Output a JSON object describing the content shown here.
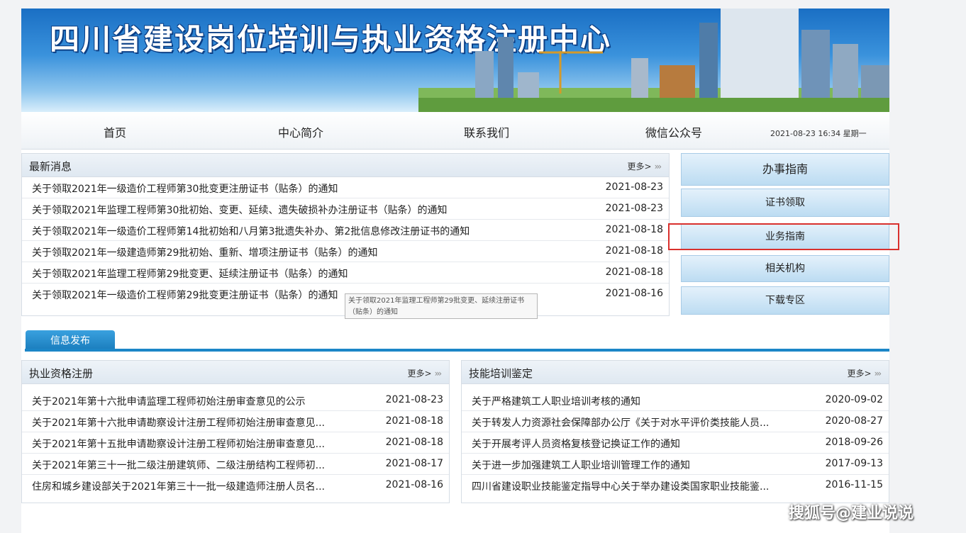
{
  "header": {
    "site_title": "四川省建设岗位培训与执业资格注册中心"
  },
  "nav": {
    "items": [
      "首页",
      "中心简介",
      "联系我们",
      "微信公众号"
    ],
    "datetime": "2021-08-23 16:34 星期一"
  },
  "news": {
    "title": "最新消息",
    "more": "更多>",
    "items": [
      {
        "text": "关于领取2021年一级造价工程师第30批变更注册证书（贴条）的通知",
        "date": "2021-08-23"
      },
      {
        "text": "关于领取2021年监理工程师第30批初始、变更、延续、遗失破损补办注册证书（贴条）的通知",
        "date": "2021-08-23"
      },
      {
        "text": "关于领取2021年一级造价工程师第14批初始和八月第3批遗失补办、第2批信息修改注册证书的通知",
        "date": "2021-08-18"
      },
      {
        "text": "关于领取2021年一级建造师第29批初始、重新、增项注册证书（贴条）的通知",
        "date": "2021-08-18"
      },
      {
        "text": "关于领取2021年监理工程师第29批变更、延续注册证书（贴条）的通知",
        "date": "2021-08-18"
      },
      {
        "text": "关于领取2021年一级造价工程师第29批变更注册证书（贴条）的通知",
        "date": "2021-08-16"
      }
    ],
    "tooltip": "关于领取2021年监理工程师第29批变更、延续注册证书（贴条）的通知"
  },
  "sidebar": {
    "items": [
      "办事指南",
      "证书领取",
      "业务指南",
      "相关机构",
      "下载专区"
    ]
  },
  "tab": {
    "label": "信息发布"
  },
  "registration": {
    "title": "执业资格注册",
    "more": "更多>",
    "items": [
      {
        "text": "关于2021年第十六批申请监理工程师初始注册审查意见的公示",
        "date": "2021-08-23"
      },
      {
        "text": "关于2021年第十六批申请勘察设计注册工程师初始注册审查意见...",
        "date": "2021-08-18"
      },
      {
        "text": "关于2021年第十五批申请勘察设计注册工程师初始注册审查意见...",
        "date": "2021-08-18"
      },
      {
        "text": "关于2021年第三十一批二级注册建筑师、二级注册结构工程师初...",
        "date": "2021-08-17"
      },
      {
        "text": "住房和城乡建设部关于2021年第三十一批一级建造师注册人员名...",
        "date": "2021-08-16"
      }
    ]
  },
  "training": {
    "title": "技能培训鉴定",
    "more": "更多>",
    "items": [
      {
        "text": "关于严格建筑工人职业培训考核的通知",
        "date": "2020-09-02"
      },
      {
        "text": "关于转发人力资源社会保障部办公厅《关于对水平评价类技能人员...",
        "date": "2020-08-27"
      },
      {
        "text": "关于开展考评人员资格复核登记换证工作的通知",
        "date": "2018-09-26"
      },
      {
        "text": "关于进一步加强建筑工人职业培训管理工作的通知",
        "date": "2017-09-13"
      },
      {
        "text": "四川省建设职业技能鉴定指导中心关于举办建设类国家职业技能鉴...",
        "date": "2016-11-15"
      }
    ]
  },
  "watermark": "搜狐号@建业说说",
  "colors": {
    "accent": "#1c86c7",
    "highlight": "#d9302d"
  }
}
